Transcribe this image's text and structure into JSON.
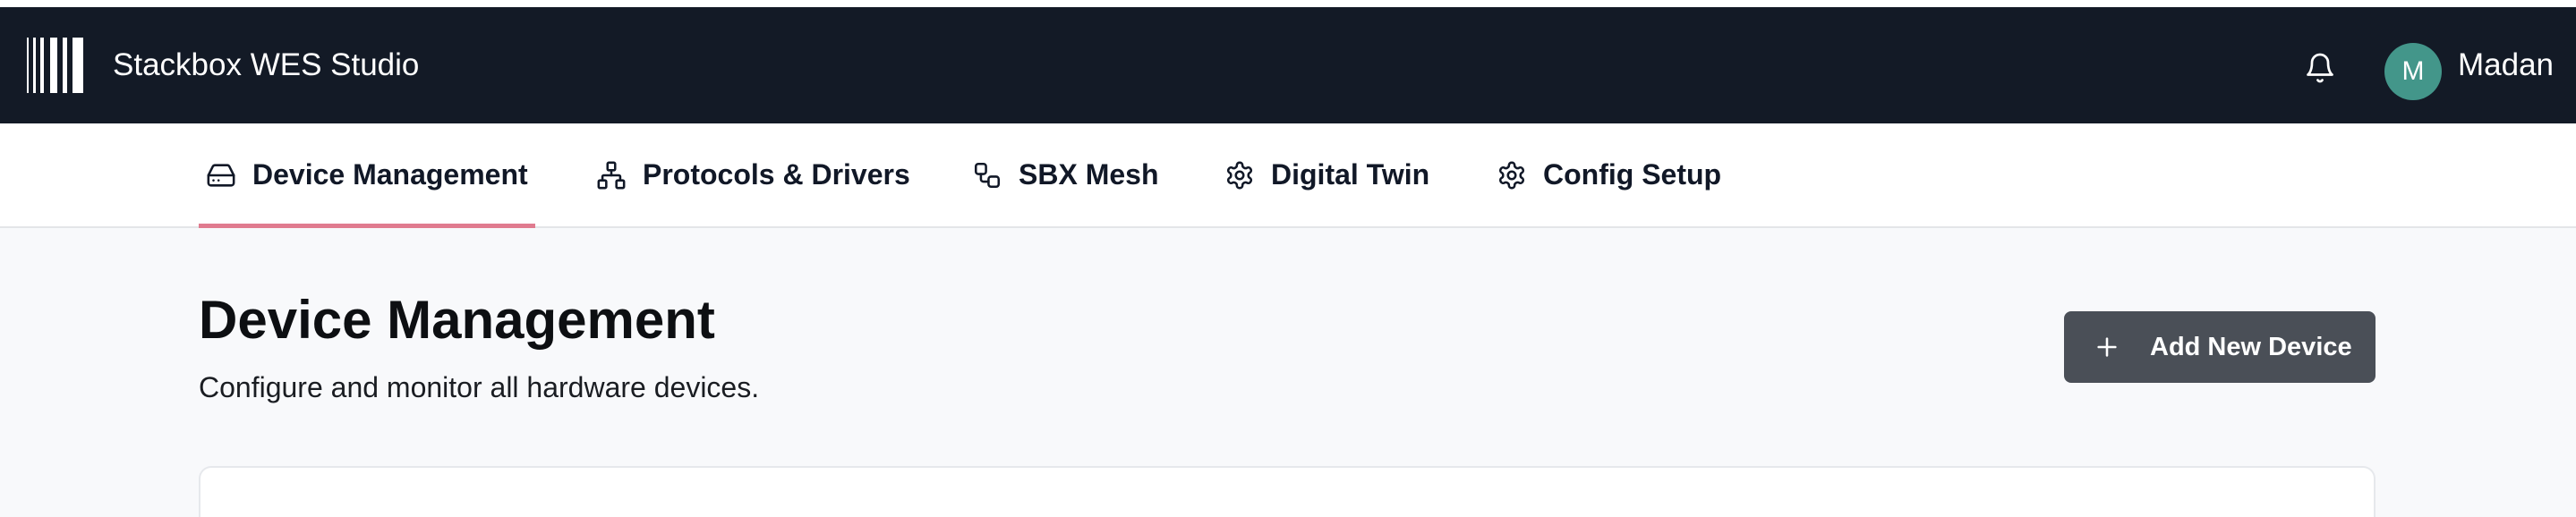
{
  "header": {
    "app_title": "Stackbox WES Studio",
    "user_initial": "M",
    "user_name": "Madan",
    "icons": {
      "logo": "barcode-logo",
      "notifications": "bell-icon"
    }
  },
  "tabs": [
    {
      "label": "Device Management",
      "icon": "hard-drive-icon",
      "active": true
    },
    {
      "label": "Protocols & Drivers",
      "icon": "network-icon",
      "active": false
    },
    {
      "label": "SBX Mesh",
      "icon": "workflow-icon",
      "active": false
    },
    {
      "label": "Digital Twin",
      "icon": "gear-icon",
      "active": false
    },
    {
      "label": "Config Setup",
      "icon": "gear-icon",
      "active": false
    }
  ],
  "page": {
    "title": "Device Management",
    "subtitle": "Configure and monitor all hardware devices.",
    "add_button_label": "Add New Device"
  },
  "colors": {
    "header_bg": "#131a26",
    "active_tab_underline": "#e07b8f",
    "avatar_bg": "#43968a",
    "primary_button": "#4a4f57",
    "content_bg": "#f8f9fb"
  }
}
